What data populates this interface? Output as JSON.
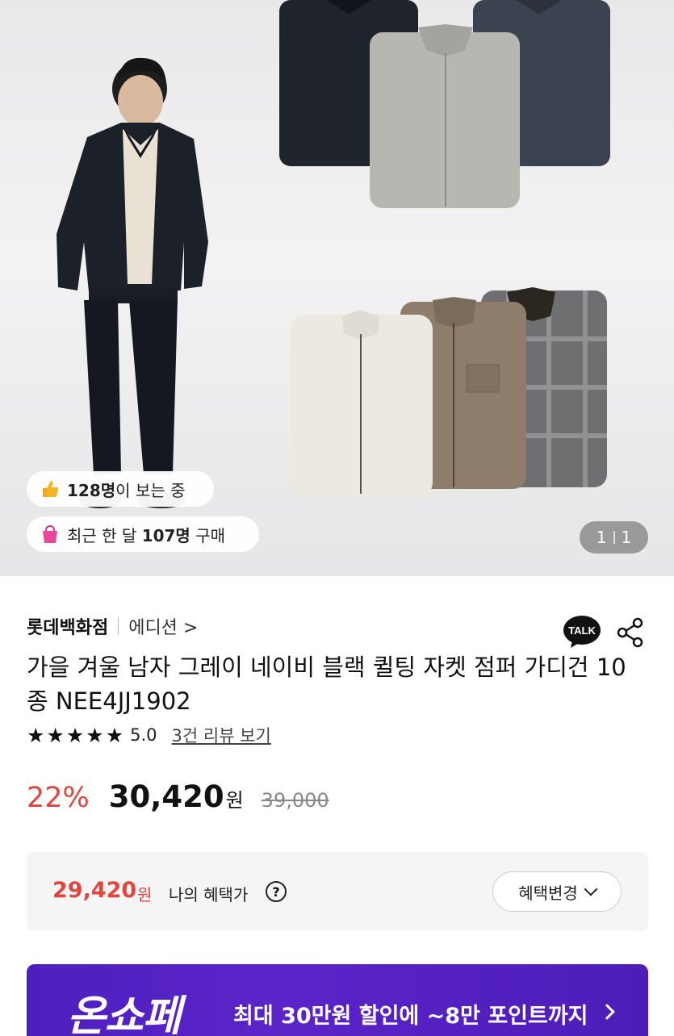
{
  "hero": {
    "viewers": {
      "count": "128명",
      "suffix": "이 보는 중"
    },
    "buyers": {
      "prefix": "최근 한 달 ",
      "count": "107명",
      "suffix": " 구매"
    },
    "pager": {
      "current": "1",
      "total": "1"
    }
  },
  "product": {
    "brand": "롯데백화점",
    "sub_brand": "에디션 >",
    "talk_label": "TALK",
    "title": "가을 겨울 남자 그레이 네이비 블랙 퀼팅 자켓 점퍼 가디건 10종 NEE4JJ1902",
    "rating": {
      "stars": 5,
      "score": "5.0",
      "review_link": "3건 리뷰 보기"
    },
    "price": {
      "discount": "22%",
      "sale": "30,420",
      "won": "원",
      "original": "39,000"
    }
  },
  "benefit": {
    "price": "29,420",
    "won": "원",
    "label": "나의 혜택가",
    "help": "?",
    "change_button": "혜택변경"
  },
  "banner": {
    "logo": "온쇼페",
    "text": "최대 30만원 할인에 ~8만 포인트까지"
  },
  "colors": {
    "accent_red": "#e0453e",
    "banner_purple": "#5b24c9"
  }
}
